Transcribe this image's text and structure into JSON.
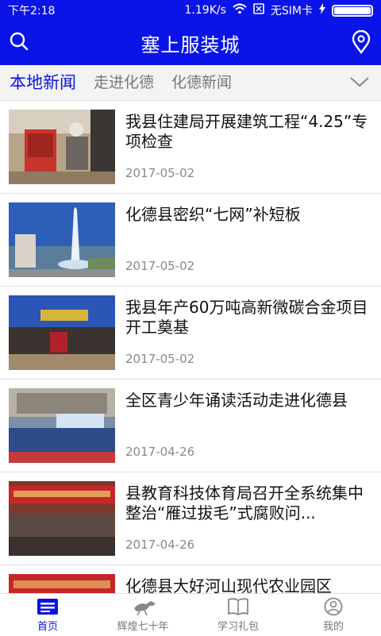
{
  "status": {
    "time": "下午2:18",
    "net_speed": "1.19K/s",
    "sim": "无SIM卡"
  },
  "header": {
    "title": "塞上服装城",
    "left_icon": "search-icon",
    "right_icon": "location-pin-icon"
  },
  "tabs": [
    {
      "label": "本地新闻",
      "active": true
    },
    {
      "label": "走进化德",
      "active": false
    },
    {
      "label": "化德新闻",
      "active": false
    }
  ],
  "news": [
    {
      "title": "我县住建局开展建筑工程“4.25”专项检查",
      "date": "2017-05-02"
    },
    {
      "title": "化德县密织“七网”补短板",
      "date": "2017-05-02"
    },
    {
      "title": "我县年产60万吨高新微碳合金项目开工奠基",
      "date": "2017-05-02"
    },
    {
      "title": "全区青少年诵读活动走进化德县",
      "date": "2017-04-26"
    },
    {
      "title": "县教育科技体育局召开全系统集中整治“雁过拔毛”式腐败问...",
      "date": "2017-04-26"
    },
    {
      "title": "化德县大好河山现代农业园区",
      "date": ""
    }
  ],
  "bottom_nav": [
    {
      "label": "首页",
      "icon": "home-news-icon",
      "active": true
    },
    {
      "label": "辉煌七十年",
      "icon": "horse-icon",
      "active": false
    },
    {
      "label": "学习礼包",
      "icon": "book-icon",
      "active": false
    },
    {
      "label": "我的",
      "icon": "user-icon",
      "active": false
    }
  ],
  "colors": {
    "brand": "#0a14e8",
    "text": "#111111",
    "muted": "#888888"
  }
}
